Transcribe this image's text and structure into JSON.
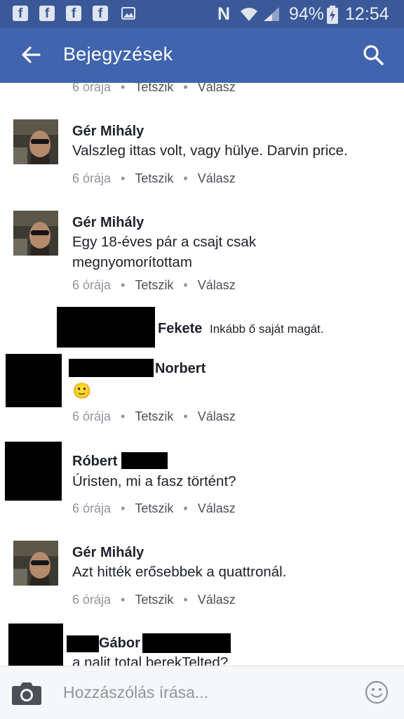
{
  "status_bar": {
    "notification_icons": [
      "facebook-icon",
      "facebook-icon",
      "facebook-icon",
      "facebook-icon",
      "image-icon"
    ],
    "battery": "94%",
    "time": "12:54",
    "nfc_letter": "N"
  },
  "header": {
    "title": "Bejegyzések"
  },
  "actions": {
    "like": "Tetszik",
    "reply": "Válasz"
  },
  "comments": [
    {
      "time": "6 órája"
    },
    {
      "author": "Gér Mihály",
      "text": "Valszleg ittas volt, vagy hülye. Darvin price.",
      "time": "6 órája"
    },
    {
      "author": "Gér Mihály",
      "text_lines": [
        "Egy 18-éves pár a csajt csak",
        "megnyomorítottam"
      ],
      "time": "6 órája"
    },
    {
      "author_suffix": "Fekete",
      "text": "Inkább ő saját magát."
    },
    {
      "author_suffix": "Norbert",
      "emoji": "🙂",
      "time": "6 órája"
    },
    {
      "author": "Róbert",
      "text": "Úristen, mi a fasz történt?",
      "time": "6 órája"
    },
    {
      "author": "Gér Mihály",
      "text": "Azt hitték erősebbek a quattronál.",
      "time": "6 órája"
    },
    {
      "author_mid": "Gábor",
      "text": "a nalit total berekTelted?"
    }
  ],
  "composer": {
    "placeholder": "Hozzászólás írása..."
  },
  "colors": {
    "brand": "#4064ad",
    "status_bar": "#3b5998",
    "meta_text": "#90949c"
  }
}
